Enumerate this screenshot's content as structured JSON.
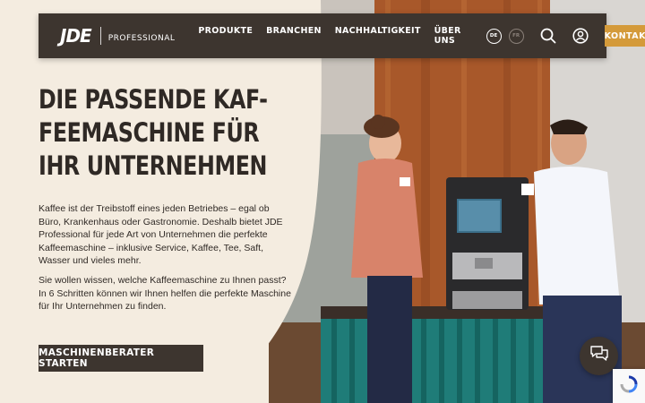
{
  "header": {
    "logo_text": "JDE",
    "logo_sub": "PROFESSIONAL",
    "nav": [
      "PRODUKTE",
      "BRANCHEN",
      "NACHHALTIGKEIT",
      "ÜBER UNS"
    ],
    "languages": [
      "DE",
      "FR"
    ],
    "active_language": "DE",
    "contact_label": "KONTAKT"
  },
  "hero": {
    "headline": [
      "DIE PASSENDE KAF-",
      "FEEMASCHINE FÜR",
      "IHR UNTERNEHMEN"
    ],
    "paragraph1": "Kaffee ist der Treibstoff eines jeden Betriebes – egal ob Büro, Krankenhaus oder Gastronomie. Deshalb bietet JDE Professional für jede Art von Unternehmen die perfekte Kaffeemaschine – inklusive Service, Kaffee, Tee, Saft, Wasser und vieles mehr.",
    "paragraph2": "Sie wollen wissen, welche Kaffeemaschine zu Ihnen passt? In 6 Schritten können wir Ihnen helfen die perfekte Maschine für Ihr Unternehmen zu finden.",
    "cta_label": "MASCHINENBERATER STARTEN"
  },
  "colors": {
    "dark": "#3d352f",
    "accent": "#d49a3a",
    "cream": "#f4ece0"
  },
  "icons": {
    "search": "search-icon",
    "account": "user-icon",
    "chat": "chat-icon",
    "recaptcha": "recaptcha-icon"
  }
}
